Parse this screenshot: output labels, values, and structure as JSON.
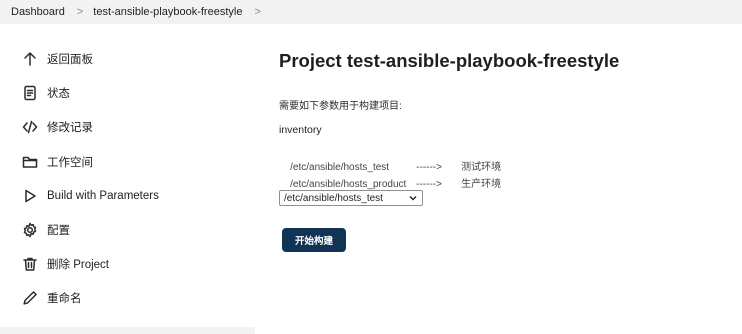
{
  "breadcrumb": {
    "items": [
      "Dashboard",
      "test-ansible-playbook-freestyle"
    ],
    "separator": ">"
  },
  "sidebar": {
    "items": [
      {
        "label": "返回面板",
        "icon": "arrow-up-icon"
      },
      {
        "label": "状态",
        "icon": "document-icon"
      },
      {
        "label": "修改记录",
        "icon": "code-icon"
      },
      {
        "label": "工作空间",
        "icon": "folder-icon"
      },
      {
        "label": "Build with Parameters",
        "icon": "play-icon"
      },
      {
        "label": "配置",
        "icon": "gear-icon"
      },
      {
        "label": "删除 Project",
        "icon": "trash-icon"
      },
      {
        "label": "重命名",
        "icon": "pencil-icon"
      }
    ]
  },
  "main": {
    "title": "Project test-ansible-playbook-freestyle",
    "description": "需要如下参数用于构建项目:",
    "parameter": {
      "name": "inventory",
      "lines": [
        {
          "path": "/etc/ansible/hosts_test",
          "arrow": "------>",
          "env": "测试环境"
        },
        {
          "path": "/etc/ansible/hosts_product",
          "arrow": "------>",
          "env": "生产环境"
        }
      ],
      "selected": "/etc/ansible/hosts_test"
    },
    "build_button": "开始构建"
  },
  "colors": {
    "accent": "#113355",
    "breadcrumb_bg": "#f2f2f3"
  }
}
